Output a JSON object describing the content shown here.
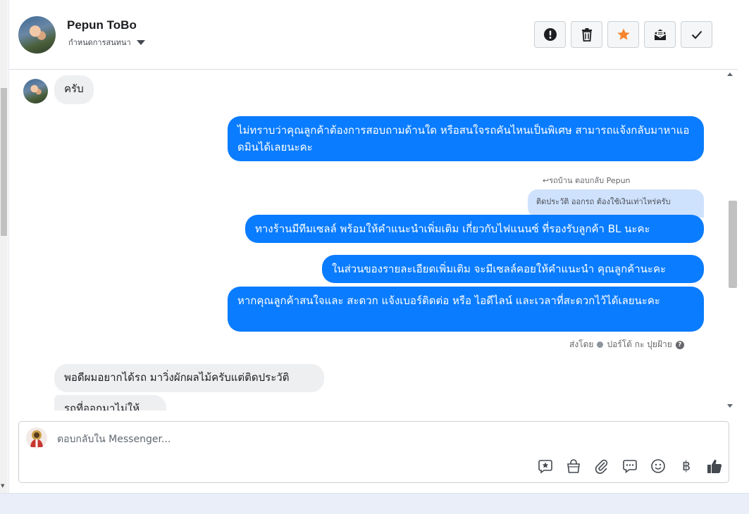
{
  "header": {
    "contact_name": "Pepun ToBo",
    "assign_label": "กำหนดการสนทนา",
    "toolbar": [
      {
        "name": "report-button",
        "icon": "exclamation-circle-icon",
        "color": "#1c1e21"
      },
      {
        "name": "delete-button",
        "icon": "trash-icon",
        "color": "#1c1e21"
      },
      {
        "name": "star-button",
        "icon": "star-icon",
        "color": "#f5842c"
      },
      {
        "name": "mark-unread-button",
        "icon": "envelope-open-icon",
        "color": "#1c1e21"
      },
      {
        "name": "mark-done-button",
        "icon": "checkmark-icon",
        "color": "#1c1e21"
      }
    ]
  },
  "thread": {
    "messages": [
      {
        "direction": "in",
        "text": "ครับ"
      },
      {
        "direction": "out",
        "text": "ไม่ทราบว่าคุณลูกค้าต้องการสอบถามด้านใด หรือสนใจรถคันไหนเป็นพิเศษ สามารถแจ้งกลับมาหาแอดมินได้เลยนะคะ"
      },
      {
        "direction": "out",
        "reply_ref": "รถบ้าน ตอบกลับ Pepun",
        "quoted": "ติดประวัติ ออกรถ ต้องใช้เงินเท่าไหร่ครับ",
        "text": "ทางร้านมีทีมเซลล์ พร้อมให้คำแนะนำเพิ่มเติม เกี่ยวกับไฟแนนซ์ ที่รองรับลูกค้า BL นะคะ"
      },
      {
        "direction": "out",
        "text": "ในส่วนของรายละเอียดเพิ่มเติม จะมีเซลล์คอยให้คำแนะนำ คุณลูกค้านะคะ"
      },
      {
        "direction": "out",
        "text": "หากคุณลูกค้าสนใจและ สะดวก แจ้งเบอร์ติดต่อ หรือ ไอดีไลน์ และเวลาที่สะดวกไว้ได้เลยนะคะ"
      },
      {
        "direction": "in",
        "text": "พอดีผมอยากได้รถ มาวิ่งผักผลไม้ครับแต่ติดประวัติ"
      },
      {
        "direction": "in",
        "text": "รถที่ออกมาไม่ให้"
      }
    ],
    "sent_by_prefix": "ส่งโดย",
    "sent_by_name": "ปอร์โต้ กะ ปุยฝ้าย",
    "help_glyph": "?"
  },
  "composer": {
    "placeholder": "ตอบกลับใน Messenger...",
    "value": "",
    "tools": [
      "saved-reply-icon",
      "shopping-bag-icon",
      "paperclip-icon",
      "chat-bubble-icon",
      "emoji-smile-icon",
      "baht-icon",
      "thumbs-up-icon"
    ],
    "baht_glyph": "฿"
  },
  "colors": {
    "outgoing_bubble": "#0a7cff",
    "incoming_bubble": "#eeeff1",
    "quoted_bubble": "#cfe2fd",
    "star_accent": "#f5842c"
  }
}
